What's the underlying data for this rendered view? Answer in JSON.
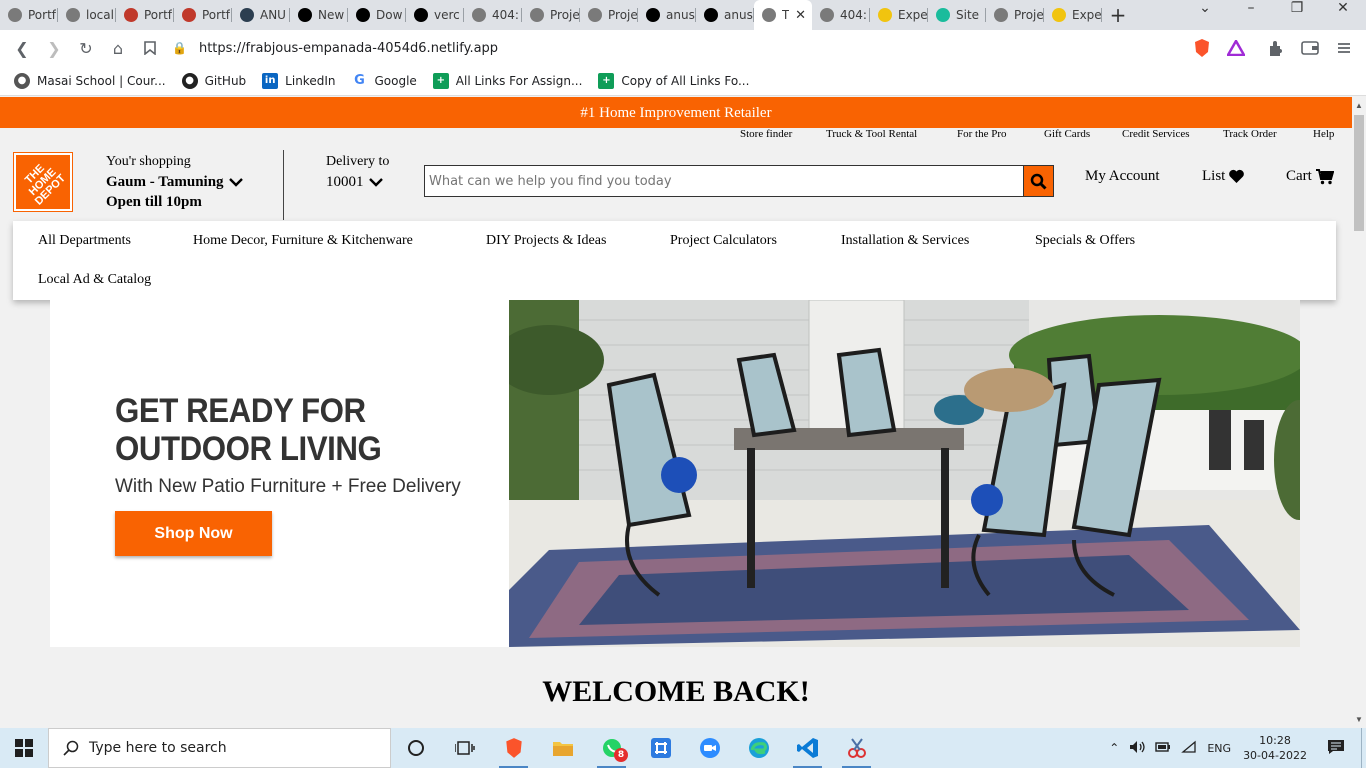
{
  "browser": {
    "tabs": [
      {
        "label": "Portf",
        "color": "#7a7a7a"
      },
      {
        "label": "local",
        "color": "#7a7a7a"
      },
      {
        "label": "Portf",
        "color": "#c0392b"
      },
      {
        "label": "Portf",
        "color": "#c0392b"
      },
      {
        "label": "ANU",
        "color": "#2c3e50"
      },
      {
        "label": "New",
        "color": "#000000"
      },
      {
        "label": "Dow",
        "color": "#000000"
      },
      {
        "label": "verc",
        "color": "#000000"
      },
      {
        "label": "404:",
        "color": "#7a7a7a"
      },
      {
        "label": "Proje",
        "color": "#7a7a7a"
      },
      {
        "label": "Proje",
        "color": "#7a7a7a"
      },
      {
        "label": "anus",
        "color": "#000000"
      },
      {
        "label": "anus",
        "color": "#000000"
      },
      {
        "label": "T",
        "color": "#7a7a7a",
        "active": true
      },
      {
        "label": "404:",
        "color": "#7a7a7a"
      },
      {
        "label": "Expe",
        "color": "#f1c40f"
      },
      {
        "label": "Site",
        "color": "#1abc9c"
      },
      {
        "label": "Proje",
        "color": "#7a7a7a"
      },
      {
        "label": "Expe",
        "color": "#f1c40f"
      }
    ],
    "url": "https://frabjous-empanada-4054d6.netlify.app",
    "bookmarks": [
      {
        "label": "Masai School | Cour...",
        "icon": "globe-icon",
        "color": "#555555"
      },
      {
        "label": "GitHub",
        "icon": "github-icon",
        "color": "#222222"
      },
      {
        "label": "LinkedIn",
        "icon": "linkedin-icon",
        "color": "#0a66c2"
      },
      {
        "label": "Google",
        "icon": "google-icon",
        "color": "#4285f4"
      },
      {
        "label": "All Links For Assign...",
        "icon": "sheets-icon",
        "color": "#0f9d58"
      },
      {
        "label": "Copy of All Links Fo...",
        "icon": "sheets-icon",
        "color": "#0f9d58"
      }
    ]
  },
  "site": {
    "promo": "#1 Home Improvement Retailer",
    "utility_links": [
      "Store finder",
      "Truck & Tool Rental",
      "For the Pro",
      "Gift Cards",
      "Credit Services",
      "Track Order",
      "Help"
    ],
    "logo_text": "THE HOME DEPOT",
    "store": {
      "prefix": "You'r shopping",
      "name": "Gaum - Tamuning",
      "hours": "Open till 10pm"
    },
    "delivery": {
      "label": "Delivery to",
      "zip": "10001"
    },
    "search": {
      "placeholder": "What can we help you find you today"
    },
    "header_links": {
      "account": "My Account",
      "list": "List",
      "cart": "Cart"
    },
    "departments": [
      "All Departments",
      "Home Decor, Furniture & Kitchenware",
      "DIY Projects & Ideas",
      "Project Calculators",
      "Installation & Services",
      "Specials & Offers",
      "Local Ad & Catalog"
    ],
    "hero": {
      "title_line1": "GET READY FOR",
      "title_line2": "OUTDOOR LIVING",
      "subtitle": "With New Patio Furniture + Free Delivery",
      "cta": "Shop Now"
    },
    "welcome": "WELCOME BACK!"
  },
  "taskbar": {
    "search_placeholder": "Type here to search",
    "whatsapp_badge": "8",
    "language": "ENG",
    "time": "10:28",
    "date": "30-04-2022"
  },
  "colors": {
    "brand_orange": "#f96302",
    "taskbar": "#d9eaf5"
  }
}
